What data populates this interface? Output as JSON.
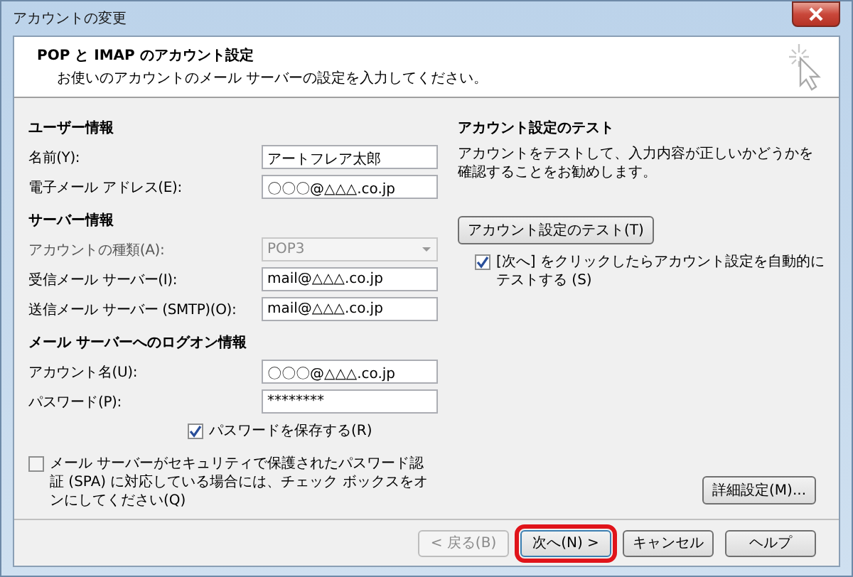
{
  "window": {
    "title": "アカウントの変更"
  },
  "header": {
    "title": "POP と IMAP のアカウント設定",
    "subtitle": "お使いのアカウントのメール サーバーの設定を入力してください。"
  },
  "left_sections": [
    {
      "heading": "ユーザー情報",
      "fields": [
        {
          "kind": "text",
          "label": "名前(Y):",
          "value": "アートフレア太郎",
          "disabled": false
        },
        {
          "kind": "text",
          "label": "電子メール アドレス(E):",
          "value": "〇〇〇@△△△.co.jp",
          "disabled": false
        }
      ]
    },
    {
      "heading": "サーバー情報",
      "fields": [
        {
          "kind": "dropdown",
          "label": "アカウントの種類(A):",
          "value": "POP3",
          "disabled": true
        },
        {
          "kind": "text",
          "label": "受信メール サーバー(I):",
          "value": "mail@△△△.co.jp",
          "disabled": false
        },
        {
          "kind": "text",
          "label": "送信メール サーバー (SMTP)(O):",
          "value": "mail@△△△.co.jp",
          "disabled": false
        }
      ]
    },
    {
      "heading": "メール サーバーへのログオン情報",
      "fields": [
        {
          "kind": "text",
          "label": "アカウント名(U):",
          "value": "〇〇〇@△△△.co.jp",
          "disabled": false
        },
        {
          "kind": "text",
          "label": "パスワード(P):",
          "value": "********",
          "disabled": false
        }
      ]
    }
  ],
  "save_password": {
    "label": "パスワードを保存する(R)",
    "checked": true
  },
  "spa": {
    "label": "メール サーバーがセキュリティで保護されたパスワード認証 (SPA) に対応している場合には、チェック ボックスをオンにしてください(Q)",
    "checked": false
  },
  "test": {
    "heading": "アカウント設定のテスト",
    "description": "アカウントをテストして、入力内容が正しいかどうかを確認することをお勧めします。",
    "button": "アカウント設定のテスト(T)",
    "auto_test": {
      "label": "[次へ] をクリックしたらアカウント設定を自動的にテストする (S)",
      "checked": true
    }
  },
  "advanced_button": "詳細設定(M)...",
  "buttons": [
    {
      "label": "< 戻る(B)",
      "disabled": true,
      "highlighted": false
    },
    {
      "label": "次へ(N) >",
      "disabled": false,
      "highlighted": true
    },
    {
      "label": "キャンセル",
      "disabled": false,
      "highlighted": false
    },
    {
      "label": "ヘルプ",
      "disabled": false,
      "highlighted": false
    }
  ]
}
